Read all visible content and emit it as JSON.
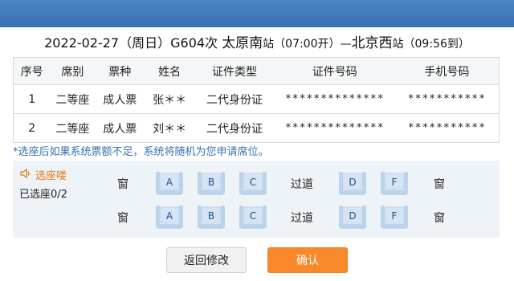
{
  "train": {
    "date": "2022-02-27（周日）G604次",
    "from_station": "太原南",
    "from_suffix": "站（07:00开）—",
    "to_station": "北京西",
    "to_suffix": "站（09:56到）"
  },
  "table": {
    "headers": [
      "序号",
      "席别",
      "票种",
      "姓名",
      "证件类型",
      "证件号码",
      "手机号码"
    ],
    "rows": [
      [
        "1",
        "二等座",
        "成人票",
        "张＊＊",
        "二代身份证",
        "**************",
        "***********"
      ],
      [
        "2",
        "二等座",
        "成人票",
        "刘＊＊",
        "二代身份证",
        "**************",
        "***********"
      ]
    ]
  },
  "note": "*选座后如果系统票额不足，系统将随机为您申请席位。",
  "seat_panel": {
    "floor_label": "选座喽",
    "selected_count": "已选座0/2",
    "window_label": "窗",
    "aisle_label": "过道",
    "rows": [
      {
        "seats": [
          "A",
          "B",
          "C",
          "D",
          "F"
        ]
      },
      {
        "seats": [
          "A",
          "B",
          "C",
          "D",
          "F"
        ]
      }
    ]
  },
  "buttons": {
    "back": "返回修改",
    "confirm": "确认"
  },
  "icons": {
    "speaker": "speaker-icon",
    "seat": "seat-icon"
  },
  "colors": {
    "accent": "#3a70b2",
    "confirm": "#f7892a",
    "seat_fill": "#bcd3ec"
  }
}
